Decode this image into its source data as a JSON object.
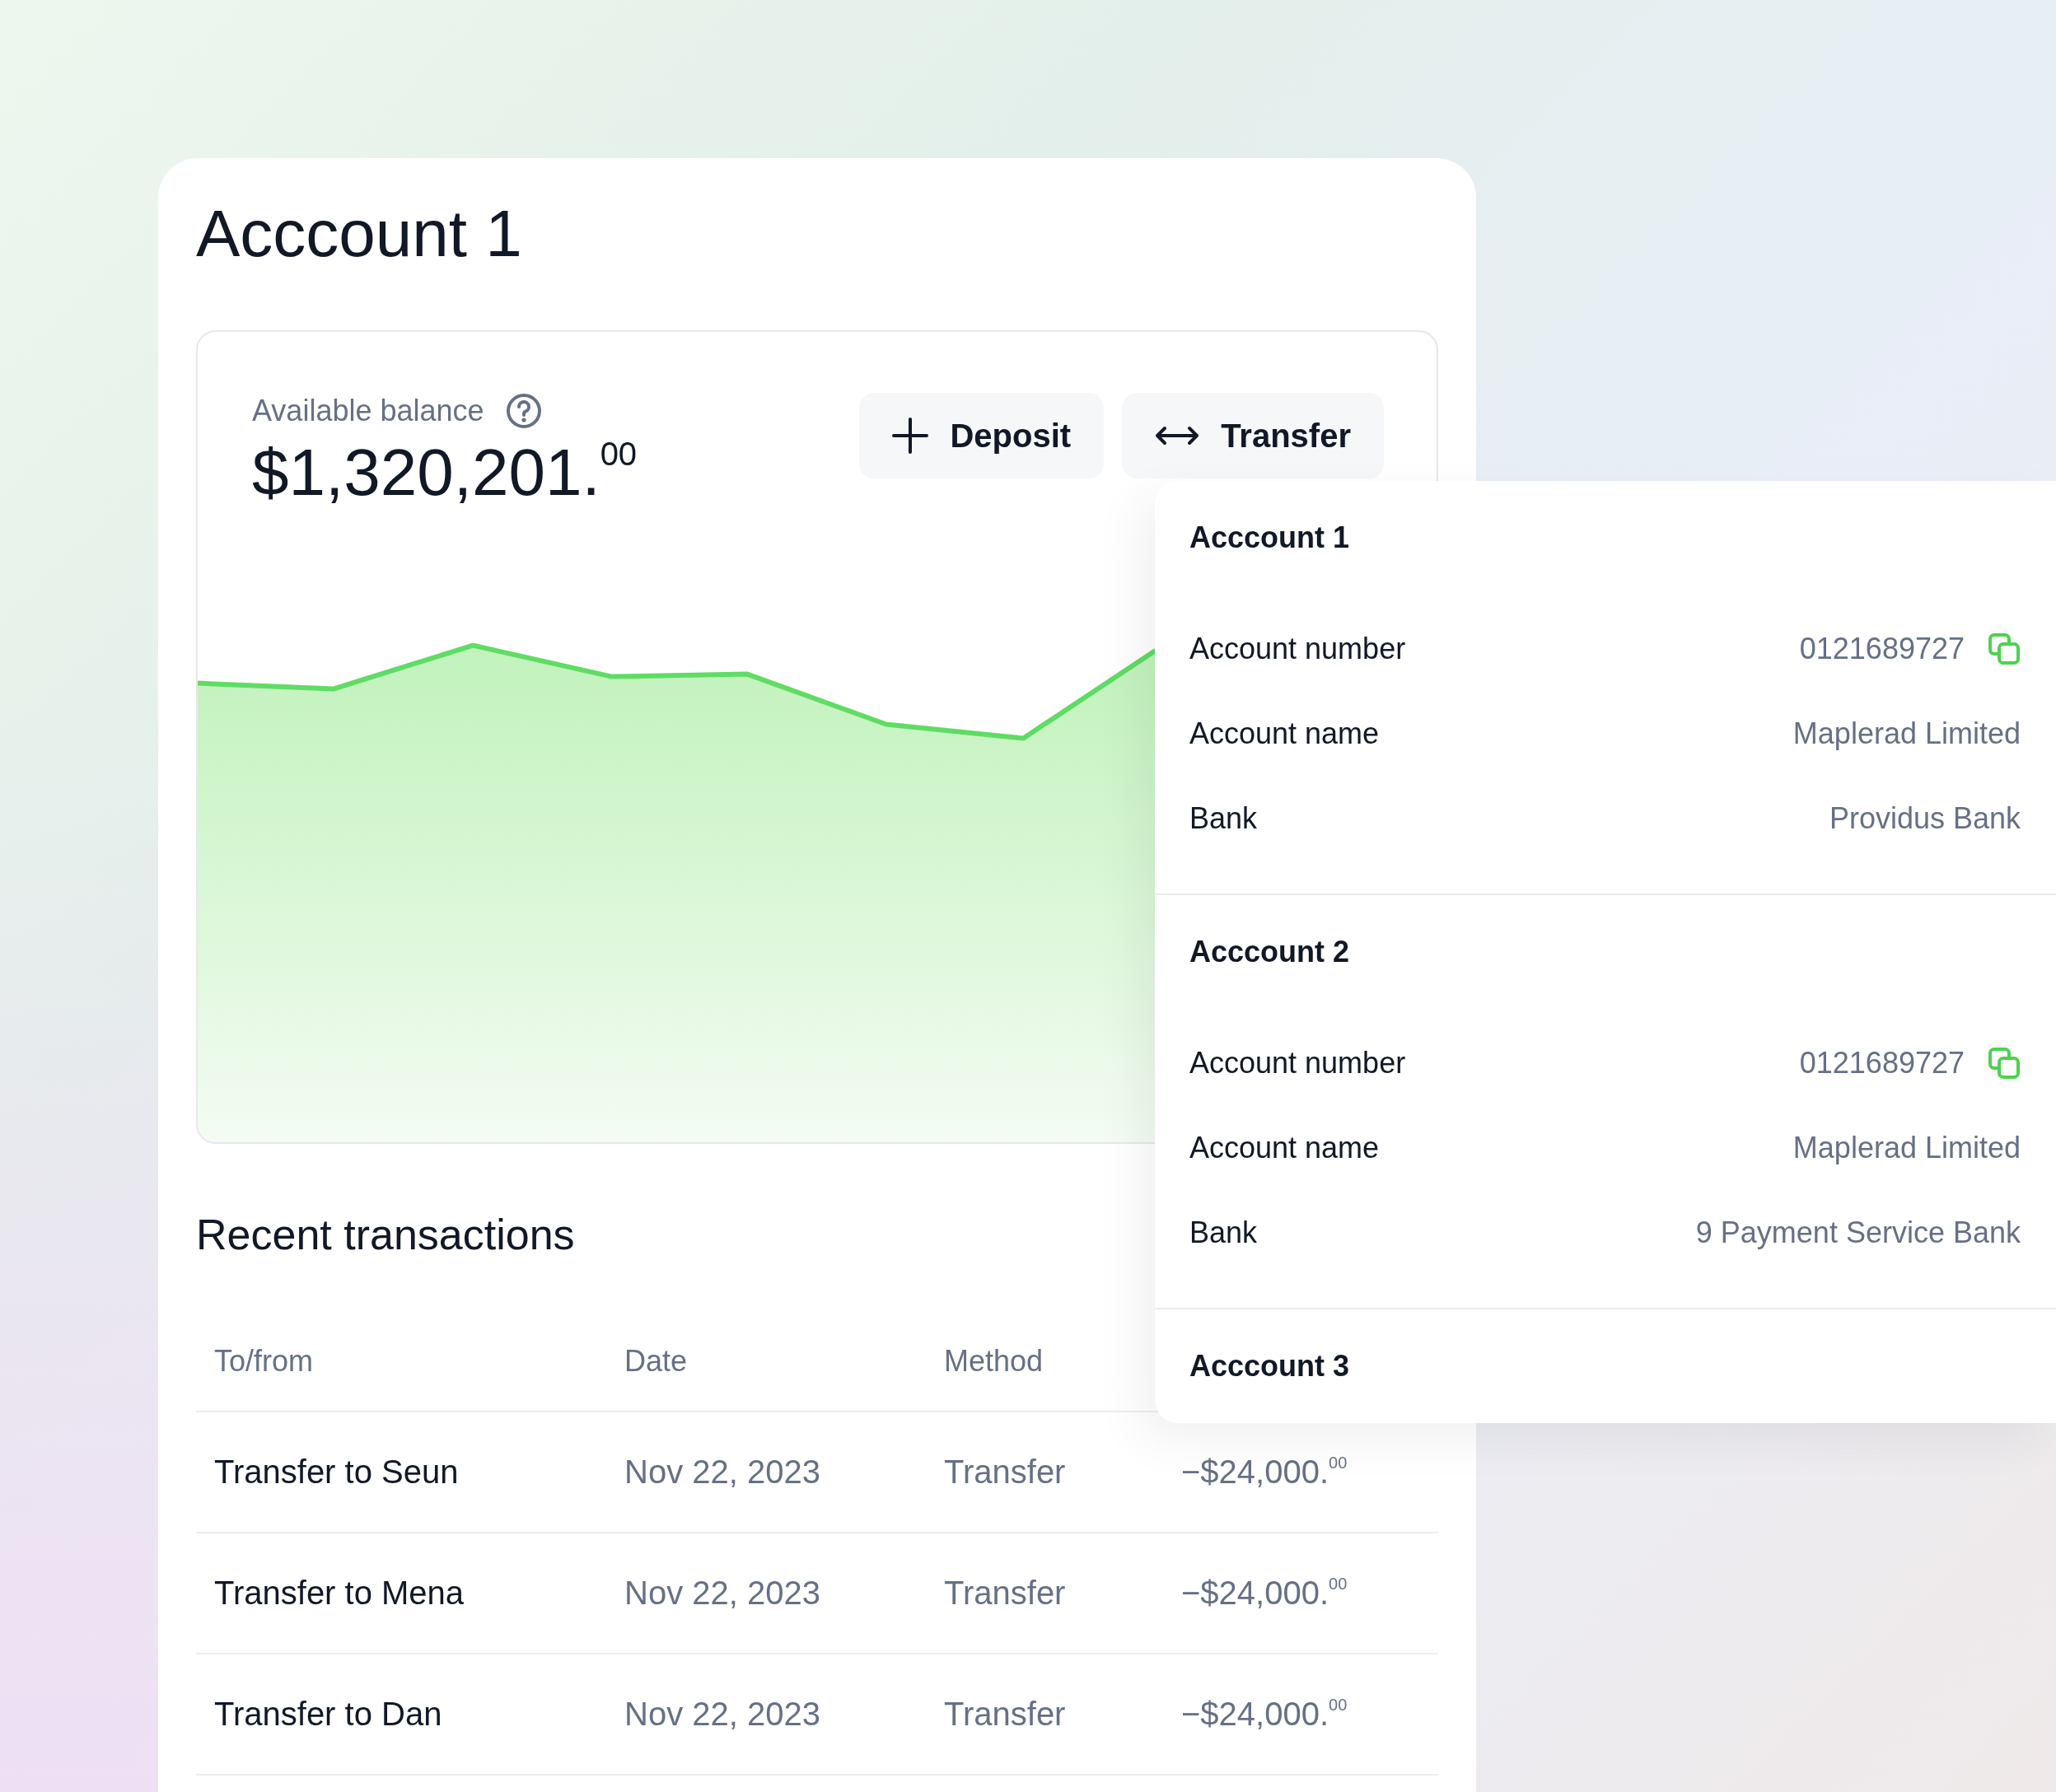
{
  "title": "Acccount 1",
  "balance": {
    "label": "Available balance",
    "amount": "$1,320,201.$^{00}$"
  },
  "actions": [
    {
      "kind": "deposit",
      "label": "Deposit"
    },
    {
      "kind": "transfer",
      "label": "Transfer"
    }
  ],
  "transactions": {
    "title": "Recent transactions",
    "columns": [
      "To/from",
      "Date",
      "Method"
    ],
    "rows": [
      {
        "party": "Transfer to Seun",
        "date": "Nov 22, 2023",
        "method": "Transfer",
        "amount": "−$24,000.$^{00}$"
      },
      {
        "party": "Transfer to Mena",
        "date": "Nov 22, 2023",
        "method": "Transfer",
        "amount": "−$24,000.$^{00}$"
      },
      {
        "party": "Transfer to Dan",
        "date": "Nov 22, 2023",
        "method": "Transfer",
        "amount": "−$24,000.$^{00}$"
      }
    ]
  },
  "accounts_menu": {
    "accounts": [
      {
        "name": "Acccount 1",
        "details": [
          {
            "label": "Account number",
            "value": "0121689727",
            "copyable": true
          },
          {
            "label": "Account name",
            "value": "Maplerad Limited",
            "copyable": false
          },
          {
            "label": "Bank",
            "value": "Providus Bank",
            "copyable": false
          }
        ]
      },
      {
        "name": "Acccount 2",
        "details": [
          {
            "label": "Account number",
            "value": "0121689727",
            "copyable": true
          },
          {
            "label": "Account name",
            "value": "Maplerad Limited",
            "copyable": false
          },
          {
            "label": "Bank",
            "value": "9 Payment Service Bank",
            "copyable": false
          }
        ]
      },
      {
        "name": "Acccount 3"
      }
    ]
  }
}
